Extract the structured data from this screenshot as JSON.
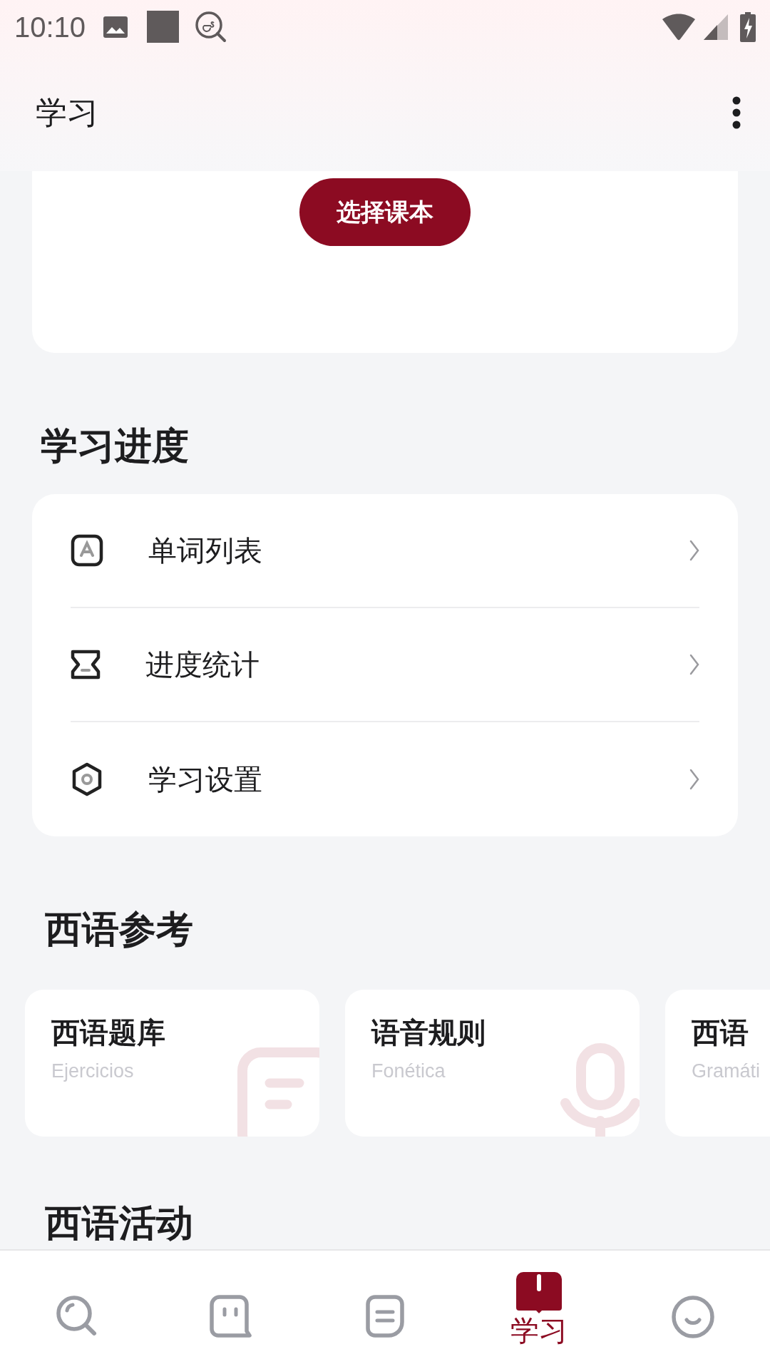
{
  "status_bar": {
    "time": "10:10"
  },
  "app_bar": {
    "title": "学习"
  },
  "textbook_card": {
    "button": "选择课本"
  },
  "progress_section": {
    "heading": "学习进度",
    "items": [
      {
        "label": "单词列表"
      },
      {
        "label": "进度统计"
      },
      {
        "label": "学习设置"
      }
    ]
  },
  "reference_section": {
    "heading": "西语参考",
    "cards": [
      {
        "title": "西语题库",
        "subtitle": "Ejercicios"
      },
      {
        "title": "语音规则",
        "subtitle": "Fonética"
      },
      {
        "title": "西语",
        "subtitle": "Gramáti"
      }
    ]
  },
  "activity_section": {
    "heading": "西语活动"
  },
  "bottom_nav": [
    {
      "selected": false
    },
    {
      "selected": false
    },
    {
      "selected": false
    },
    {
      "selected": true,
      "label": "学习"
    },
    {
      "selected": false
    }
  ]
}
